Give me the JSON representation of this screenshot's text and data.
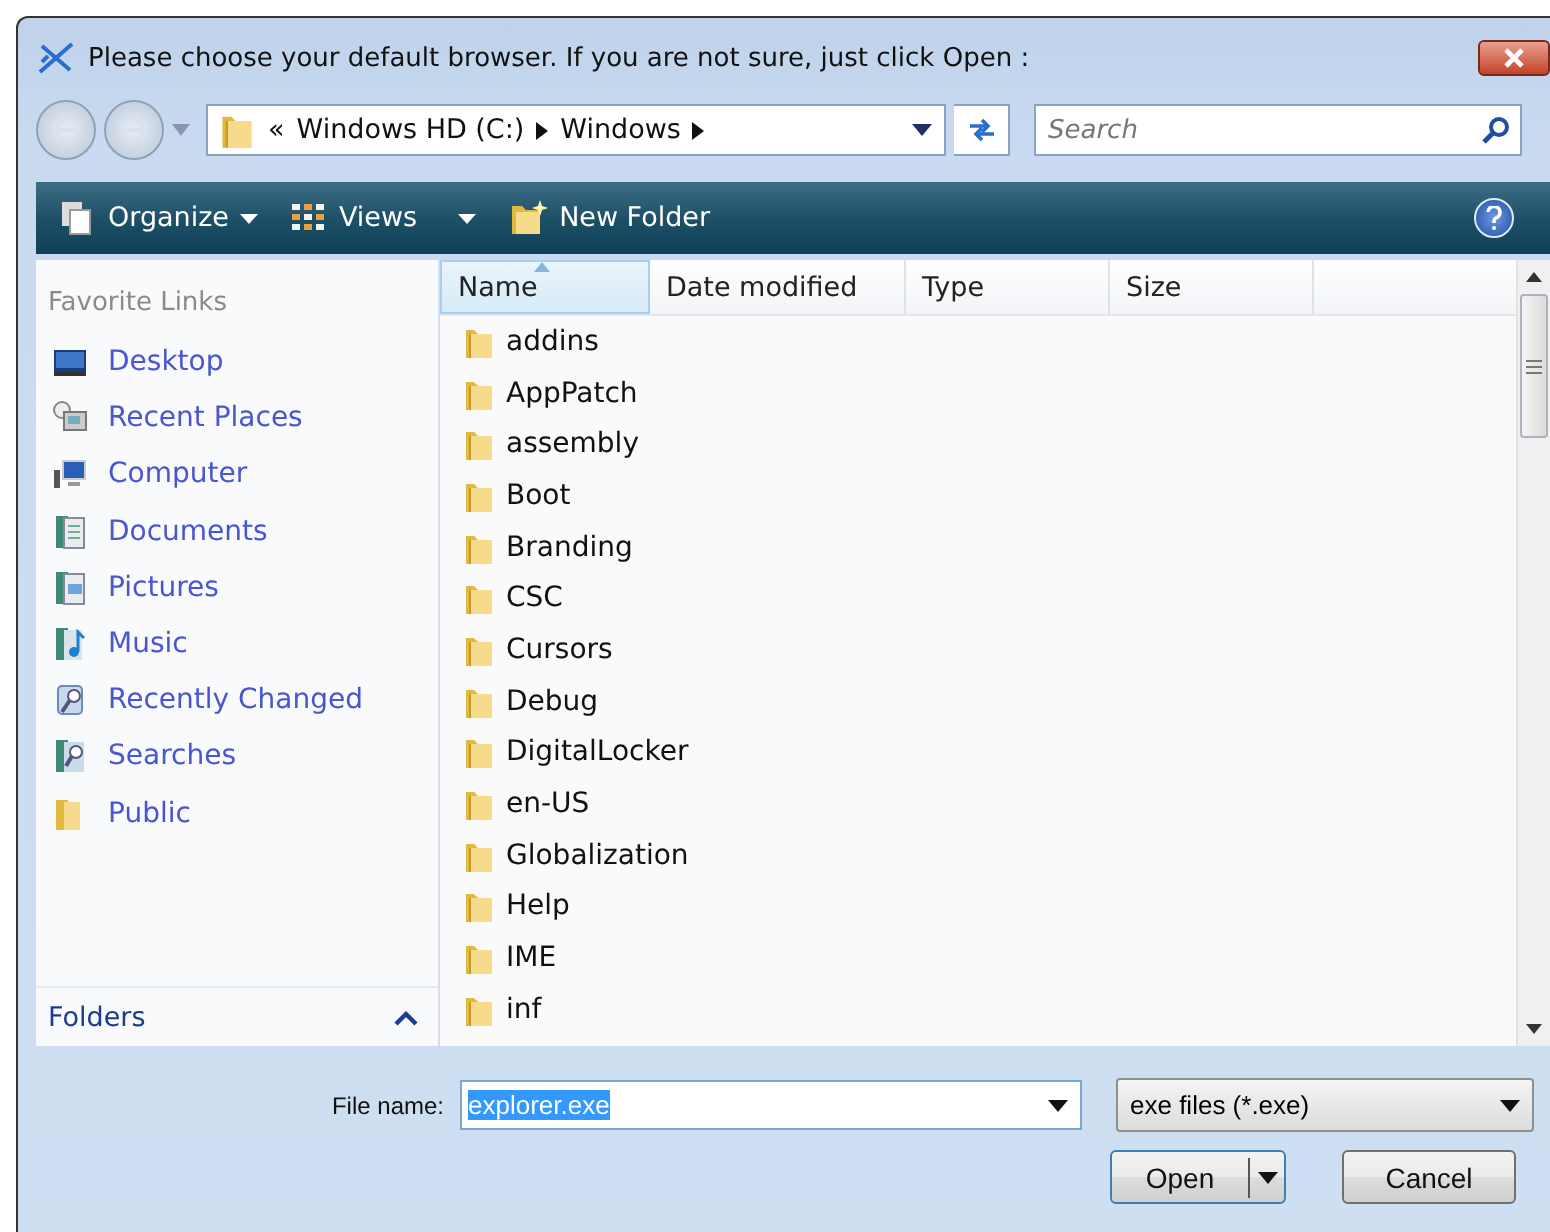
{
  "window": {
    "title": "Please choose your default browser. If you are not sure, just click Open :"
  },
  "address": {
    "overflow": "«",
    "crumbs": [
      "Windows HD (C:)",
      "Windows"
    ]
  },
  "search": {
    "placeholder": "Search"
  },
  "toolbar": {
    "organize": "Organize",
    "views": "Views",
    "new_folder": "New Folder"
  },
  "sidebar": {
    "heading": "Favorite Links",
    "items": [
      "Desktop",
      "Recent Places",
      "Computer",
      "Documents",
      "Pictures",
      "Music",
      "Recently Changed",
      "Searches",
      "Public"
    ],
    "folders": {
      "label": "Folders",
      "expanded": true
    }
  },
  "table": {
    "columns": [
      {
        "label": "Name",
        "selected": true
      },
      {
        "label": "Date modified",
        "selected": false
      },
      {
        "label": "Type",
        "selected": false
      },
      {
        "label": "Size",
        "selected": false
      }
    ],
    "rows": [
      "addins",
      "AppPatch",
      "assembly",
      "Boot",
      "Branding",
      "CSC",
      "Cursors",
      "Debug",
      "DigitalLocker",
      "en-US",
      "Globalization",
      "Help",
      "IME",
      "inf"
    ]
  },
  "footer": {
    "file_name_label": "File name:",
    "file_name": "explorer.exe",
    "file_type": "exe files (*.exe)",
    "open": "Open",
    "cancel": "Cancel"
  }
}
